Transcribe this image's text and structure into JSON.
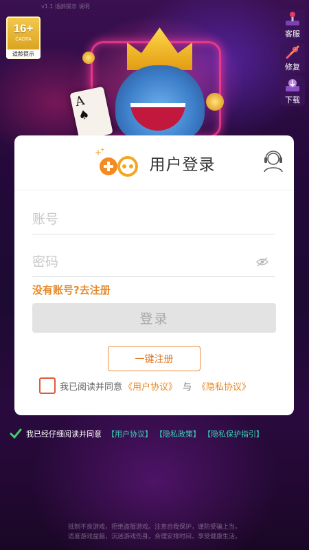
{
  "age_badge": {
    "rating": "16+",
    "org": "CADPA",
    "tip": "适龄提示"
  },
  "top_faint_text": "v1.1 适龄提示 说明",
  "side_buttons": [
    {
      "label": "客服",
      "icon": "gamepad-joystick-icon"
    },
    {
      "label": "修复",
      "icon": "wrench-icon"
    },
    {
      "label": "下载",
      "icon": "download-icon"
    }
  ],
  "dialog": {
    "title": "用户登录",
    "account_placeholder": "账号",
    "password_placeholder": "密码",
    "register_link": "没有账号?去注册",
    "login_button": "登录",
    "onekey_register": "一键注册",
    "agree_prefix": "我已阅读并同意",
    "user_agreement": "《用户协议》",
    "and": "与",
    "privacy_agreement": "《隐私协议》"
  },
  "bottom": {
    "agree_text": "我已经仔细阅读并同意",
    "user_agreement": "【用户协议】",
    "privacy_policy": "【隐私政策】",
    "privacy_guide": "【隐私保护指引】"
  },
  "footer_notice": {
    "line1": "抵制不良游戏，拒绝盗版游戏。注意自我保护，谨防受骗上当。",
    "line2": "适度游戏益脑，沉迷游戏伤身。合理安排时间，享受健康生活。"
  },
  "colors": {
    "accent_orange": "#e68a2a",
    "checkbox_red": "#e0593a",
    "bottom_link_teal": "#35d4b4",
    "login_disabled_bg": "#e3e3e3"
  }
}
